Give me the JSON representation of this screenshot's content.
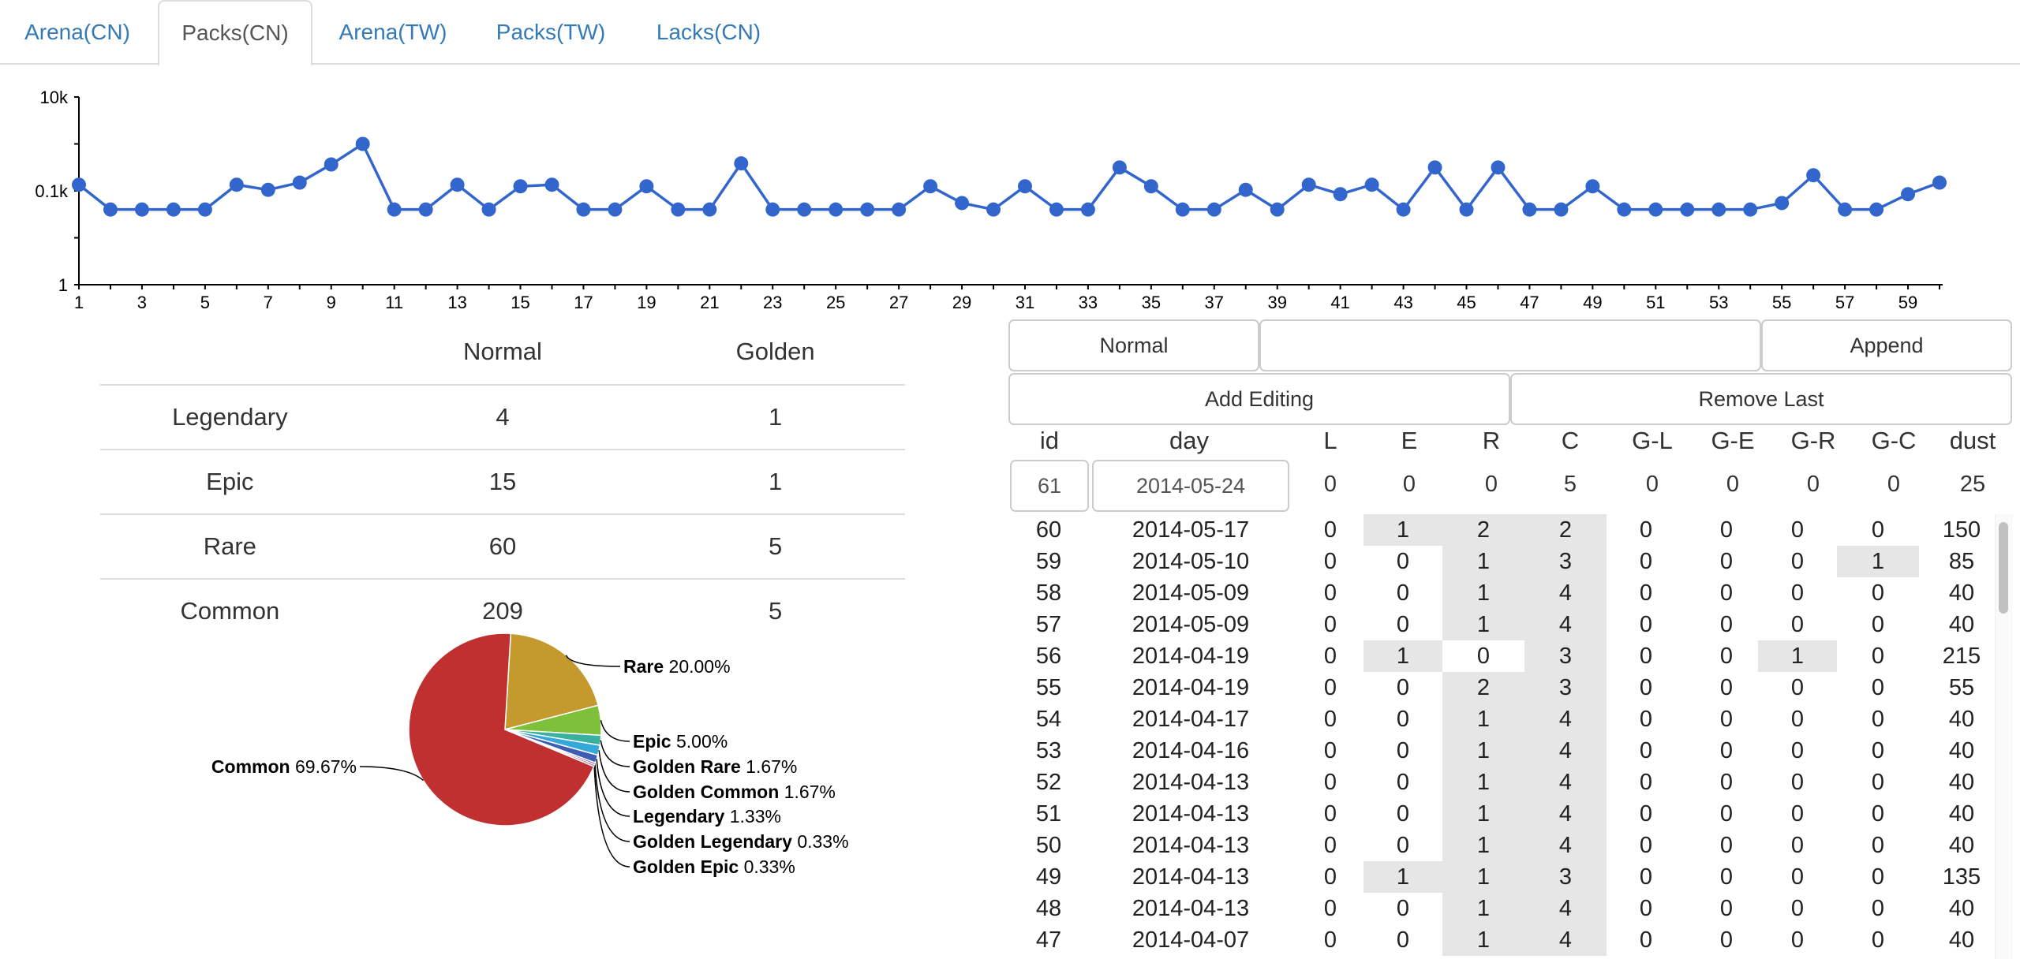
{
  "tabs": [
    {
      "label": "Arena(CN)",
      "active": false
    },
    {
      "label": "Packs(CN)",
      "active": true
    },
    {
      "label": "Arena(TW)",
      "active": false
    },
    {
      "label": "Packs(TW)",
      "active": false
    },
    {
      "label": "Lacks(CN)",
      "active": false
    }
  ],
  "chart_data": [
    {
      "type": "line",
      "y_scale": "log",
      "ylim": [
        1,
        10000
      ],
      "y_ticks": [
        "10k",
        "0.1k",
        "1"
      ],
      "xlim": [
        1,
        60
      ],
      "x_ticks": [
        "1",
        "3",
        "5",
        "7",
        "9",
        "11",
        "13",
        "15",
        "17",
        "19",
        "21",
        "23",
        "25",
        "27",
        "29",
        "31",
        "33",
        "35",
        "37",
        "39",
        "41",
        "43",
        "45",
        "47",
        "49",
        "51",
        "53",
        "55",
        "57",
        "59"
      ],
      "series": [
        {
          "color": "#3366cc",
          "x": [
            1,
            2,
            3,
            4,
            5,
            6,
            7,
            8,
            9,
            10,
            11,
            12,
            13,
            14,
            15,
            16,
            17,
            18,
            19,
            20,
            21,
            22,
            23,
            24,
            25,
            26,
            27,
            28,
            29,
            30,
            31,
            32,
            33,
            34,
            35,
            36,
            37,
            38,
            39,
            40,
            41,
            42,
            43,
            44,
            45,
            46,
            47,
            48,
            49,
            50,
            51,
            52,
            53,
            54,
            55,
            56,
            57,
            58,
            59,
            60
          ],
          "y": [
            135,
            40,
            40,
            40,
            40,
            135,
            105,
            150,
            365,
            1000,
            40,
            40,
            135,
            40,
            125,
            135,
            40,
            40,
            125,
            40,
            40,
            385,
            40,
            40,
            40,
            40,
            40,
            125,
            55,
            40,
            125,
            40,
            40,
            315,
            125,
            40,
            40,
            105,
            40,
            135,
            85,
            135,
            40,
            315,
            40,
            315,
            40,
            40,
            125,
            40,
            40,
            40,
            40,
            40,
            55,
            215,
            40,
            40,
            85,
            150
          ]
        }
      ]
    },
    {
      "type": "pie",
      "slices": [
        {
          "label": "Rare",
          "pct": "20.00%",
          "value": 20.0,
          "color": "#c49a2e"
        },
        {
          "label": "Epic",
          "pct": "5.00%",
          "value": 5.0,
          "color": "#7fc03a"
        },
        {
          "label": "Golden Rare",
          "pct": "1.67%",
          "value": 1.67,
          "color": "#39b0a0"
        },
        {
          "label": "Golden Common",
          "pct": "1.67%",
          "value": 1.67,
          "color": "#34a8d8"
        },
        {
          "label": "Legendary",
          "pct": "1.33%",
          "value": 1.33,
          "color": "#3d5db5"
        },
        {
          "label": "Golden Legendary",
          "pct": "0.33%",
          "value": 0.33,
          "color": "#8a4fb5"
        },
        {
          "label": "Golden Epic",
          "pct": "0.33%",
          "value": 0.33,
          "color": "#c0447a"
        },
        {
          "label": "Common",
          "pct": "69.67%",
          "value": 69.67,
          "color": "#c03030"
        }
      ]
    }
  ],
  "stats": {
    "headers": [
      "",
      "Normal",
      "Golden"
    ],
    "rows": [
      {
        "rarity": "Legendary",
        "normal": "4",
        "golden": "1"
      },
      {
        "rarity": "Epic",
        "normal": "15",
        "golden": "1"
      },
      {
        "rarity": "Rare",
        "normal": "60",
        "golden": "5"
      },
      {
        "rarity": "Common",
        "normal": "209",
        "golden": "5"
      }
    ]
  },
  "editor": {
    "normal_label": "Normal",
    "append_label": "Append",
    "add_editing_label": "Add Editing",
    "remove_last_label": "Remove Last",
    "headers": [
      "id",
      "day",
      "L",
      "E",
      "R",
      "C",
      "G-L",
      "G-E",
      "G-R",
      "G-C",
      "dust"
    ],
    "new_row": {
      "id": "61",
      "day": "2014-05-24",
      "values": [
        "0",
        "0",
        "0",
        "5",
        "0",
        "0",
        "0",
        "0",
        "25"
      ]
    },
    "rows": [
      {
        "id": "60",
        "day": "2014-05-17",
        "values": [
          "0",
          "1",
          "2",
          "2",
          "0",
          "0",
          "0",
          "0",
          "150"
        ],
        "shaded": [
          false,
          true,
          true,
          true,
          false,
          false,
          false,
          false
        ]
      },
      {
        "id": "59",
        "day": "2014-05-10",
        "values": [
          "0",
          "0",
          "1",
          "3",
          "0",
          "0",
          "0",
          "1",
          "85"
        ],
        "shaded": [
          false,
          false,
          true,
          true,
          false,
          false,
          false,
          true
        ]
      },
      {
        "id": "58",
        "day": "2014-05-09",
        "values": [
          "0",
          "0",
          "1",
          "4",
          "0",
          "0",
          "0",
          "0",
          "40"
        ],
        "shaded": [
          false,
          false,
          true,
          true,
          false,
          false,
          false,
          false
        ]
      },
      {
        "id": "57",
        "day": "2014-05-09",
        "values": [
          "0",
          "0",
          "1",
          "4",
          "0",
          "0",
          "0",
          "0",
          "40"
        ],
        "shaded": [
          false,
          false,
          true,
          true,
          false,
          false,
          false,
          false
        ]
      },
      {
        "id": "56",
        "day": "2014-04-19",
        "values": [
          "0",
          "1",
          "0",
          "3",
          "0",
          "0",
          "1",
          "0",
          "215"
        ],
        "shaded": [
          false,
          true,
          false,
          true,
          false,
          false,
          true,
          false
        ]
      },
      {
        "id": "55",
        "day": "2014-04-19",
        "values": [
          "0",
          "0",
          "2",
          "3",
          "0",
          "0",
          "0",
          "0",
          "55"
        ],
        "shaded": [
          false,
          false,
          true,
          true,
          false,
          false,
          false,
          false
        ]
      },
      {
        "id": "54",
        "day": "2014-04-17",
        "values": [
          "0",
          "0",
          "1",
          "4",
          "0",
          "0",
          "0",
          "0",
          "40"
        ],
        "shaded": [
          false,
          false,
          true,
          true,
          false,
          false,
          false,
          false
        ]
      },
      {
        "id": "53",
        "day": "2014-04-16",
        "values": [
          "0",
          "0",
          "1",
          "4",
          "0",
          "0",
          "0",
          "0",
          "40"
        ],
        "shaded": [
          false,
          false,
          true,
          true,
          false,
          false,
          false,
          false
        ]
      },
      {
        "id": "52",
        "day": "2014-04-13",
        "values": [
          "0",
          "0",
          "1",
          "4",
          "0",
          "0",
          "0",
          "0",
          "40"
        ],
        "shaded": [
          false,
          false,
          true,
          true,
          false,
          false,
          false,
          false
        ]
      },
      {
        "id": "51",
        "day": "2014-04-13",
        "values": [
          "0",
          "0",
          "1",
          "4",
          "0",
          "0",
          "0",
          "0",
          "40"
        ],
        "shaded": [
          false,
          false,
          true,
          true,
          false,
          false,
          false,
          false
        ]
      },
      {
        "id": "50",
        "day": "2014-04-13",
        "values": [
          "0",
          "0",
          "1",
          "4",
          "0",
          "0",
          "0",
          "0",
          "40"
        ],
        "shaded": [
          false,
          false,
          true,
          true,
          false,
          false,
          false,
          false
        ]
      },
      {
        "id": "49",
        "day": "2014-04-13",
        "values": [
          "0",
          "1",
          "1",
          "3",
          "0",
          "0",
          "0",
          "0",
          "135"
        ],
        "shaded": [
          false,
          true,
          true,
          true,
          false,
          false,
          false,
          false
        ]
      },
      {
        "id": "48",
        "day": "2014-04-13",
        "values": [
          "0",
          "0",
          "1",
          "4",
          "0",
          "0",
          "0",
          "0",
          "40"
        ],
        "shaded": [
          false,
          false,
          true,
          true,
          false,
          false,
          false,
          false
        ]
      },
      {
        "id": "47",
        "day": "2014-04-07",
        "values": [
          "0",
          "0",
          "1",
          "4",
          "0",
          "0",
          "0",
          "0",
          "40"
        ],
        "shaded": [
          false,
          false,
          true,
          true,
          false,
          false,
          false,
          false
        ]
      }
    ]
  }
}
